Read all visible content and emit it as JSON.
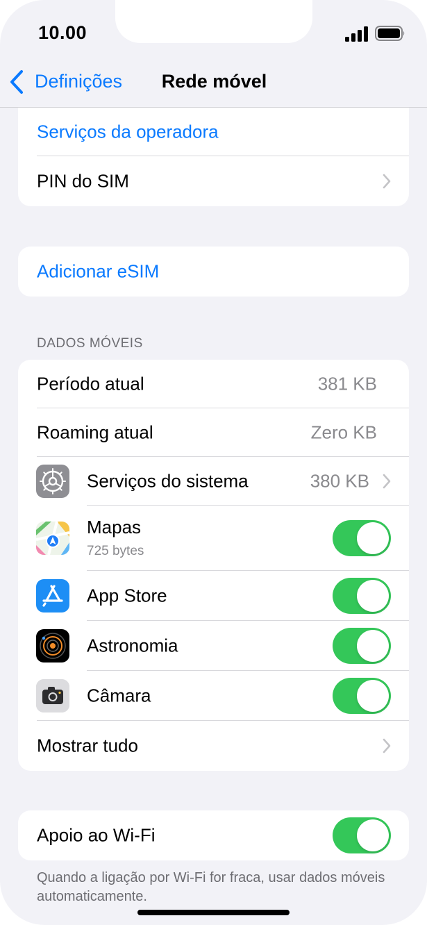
{
  "status_bar": {
    "time": "10.00",
    "icons": [
      "cellular-signal-icon",
      "battery-icon"
    ]
  },
  "nav": {
    "back_label": "Definições",
    "title": "Rede móvel"
  },
  "group_top": {
    "carrier_services": "Serviços da operadora",
    "sim_pin": "PIN do SIM"
  },
  "group_esim": {
    "add_esim": "Adicionar eSIM"
  },
  "cellular_data": {
    "header": "DADOS MÓVEIS",
    "current_period": {
      "label": "Período atual",
      "value": "381 KB"
    },
    "current_roaming": {
      "label": "Roaming atual",
      "value": "Zero KB"
    },
    "system_services": {
      "label": "Serviços do sistema",
      "value": "380 KB",
      "icon": "gear-icon"
    },
    "apps": [
      {
        "label": "Mapas",
        "sublabel": "725 bytes",
        "icon": "maps-icon",
        "enabled": true
      },
      {
        "label": "App Store",
        "icon": "app-store-icon",
        "enabled": true
      },
      {
        "label": "Astronomia",
        "icon": "astronomy-icon",
        "enabled": true
      },
      {
        "label": "Câmara",
        "icon": "camera-icon",
        "enabled": true
      }
    ],
    "show_all": "Mostrar tudo"
  },
  "wifi_assist": {
    "label": "Apoio ao Wi-Fi",
    "enabled": true,
    "footer": "Quando a ligação por Wi-Fi for fraca, usar dados móveis automaticamente."
  },
  "colors": {
    "accent": "#0a7aff",
    "toggle_on": "#34c759",
    "background": "#f2f2f7"
  }
}
